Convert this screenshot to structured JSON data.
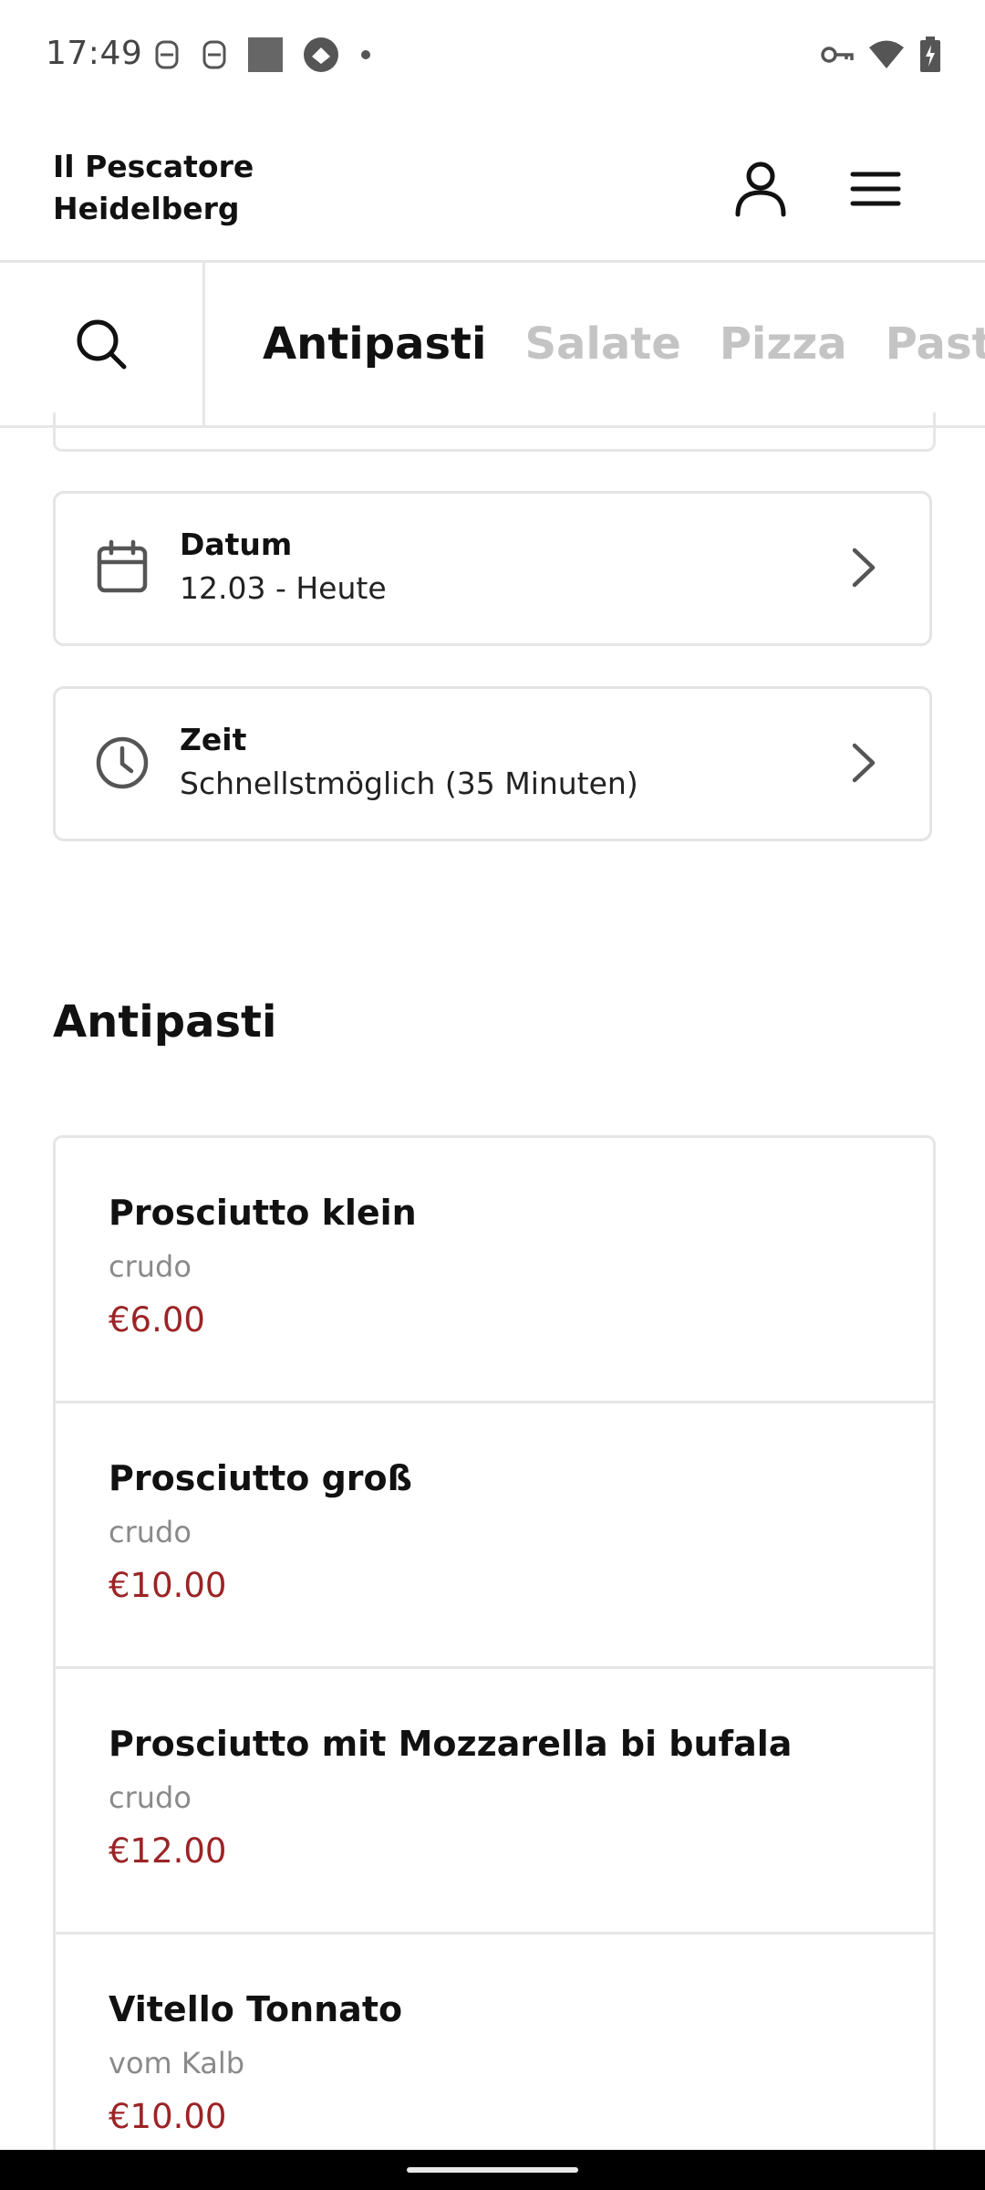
{
  "status_bar": {
    "time": "17:49",
    "left_icons": [
      "notification-icon",
      "notification-icon",
      "image-placeholder-icon",
      "app-icon",
      "dot-icon"
    ],
    "right_icons": [
      "vpn-key-icon",
      "wifi-icon",
      "battery-charging-icon"
    ]
  },
  "header": {
    "brand": "Il Pescatore\nHeidelberg",
    "account_icon": "person-icon",
    "menu_icon": "hamburger-menu-icon"
  },
  "categories": {
    "search_icon": "search-icon",
    "tabs": [
      {
        "label": "Antipasti",
        "active": true
      },
      {
        "label": "Salate",
        "active": false
      },
      {
        "label": "Pizza",
        "active": false
      },
      {
        "label": "Pasta",
        "active": false
      }
    ]
  },
  "order_options": {
    "date": {
      "title": "Datum",
      "value": "12.03 - Heute",
      "icon": "calendar-icon"
    },
    "time": {
      "title": "Zeit",
      "value": "Schnellstmöglich (35 Minuten)",
      "icon": "clock-icon"
    }
  },
  "section": {
    "title": "Antipasti"
  },
  "menu_items": [
    {
      "name": "Prosciutto klein",
      "description": "crudo",
      "price": "€6.00"
    },
    {
      "name": "Prosciutto groß",
      "description": "crudo",
      "price": "€10.00"
    },
    {
      "name": "Prosciutto mit Mozzarella bi bufala",
      "description": "crudo",
      "price": "€12.00"
    },
    {
      "name": "Vitello Tonnato",
      "description": "vom Kalb",
      "price": "€10.00"
    }
  ],
  "colors": {
    "price": "#9c2426",
    "inactive_tab": "#c4c4c4",
    "border": "#e6e6e6"
  }
}
